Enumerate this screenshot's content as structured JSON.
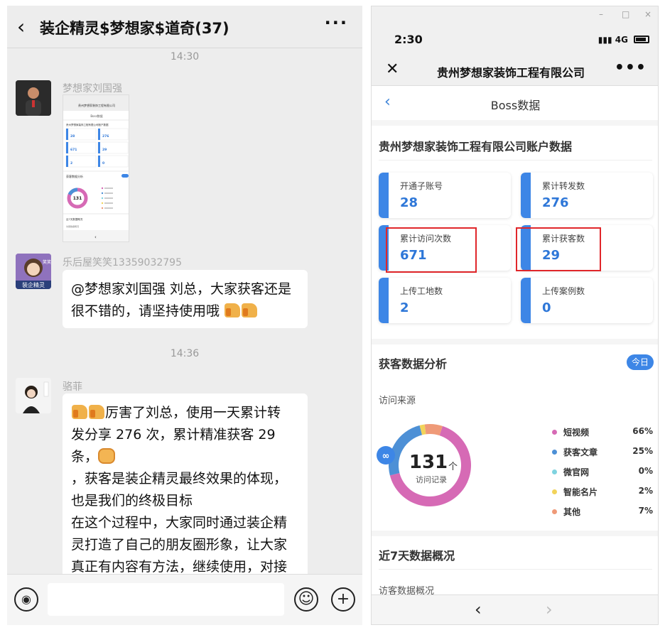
{
  "chat": {
    "title": "装企精灵$梦想家$道奇(37)",
    "back_icon": "chevron-left-icon",
    "more_icon": "more-icon",
    "messages": [
      {
        "time": "14:30",
        "sender": "梦想家刘国强",
        "type": "image"
      },
      {
        "sender": "乐后屋笑笑13359032795",
        "avatar_text": "装企精灵",
        "avatar_top": "笑笑",
        "text_lines": [
          "@梦想家刘国强 刘总，大家获客还是",
          "很不错的，请坚持使用哦 "
        ]
      },
      {
        "time": "14:36",
        "sender": "骆菲",
        "text_lines": [
          "厉害了刘总，使用一天累计转",
          "发分享 276 次，累计精准获客 29",
          "条，",
          "，获客是装企精灵最终效果的体现，",
          "也是我们的终极目标",
          "在这个过程中，大家同时通过装企精",
          "灵打造了自己的朋友圈形象，让大家",
          "真正有内容有方法，继续使用，对接"
        ]
      }
    ],
    "bottom": {
      "voice_icon": "voice-icon",
      "emoji_icon": "emoji-icon",
      "add_icon": "add-icon"
    }
  },
  "thumbnail": {
    "company": "贵州梦想家装饰工程有限公司",
    "page": "Boss数据",
    "account_title": "贵州梦想家装饰工程有限公司账户数据",
    "values": [
      "28",
      "276",
      "671",
      "29",
      "2",
      "0"
    ],
    "center": "131",
    "analysis": "获客数据分析",
    "week": "近7天数据概况",
    "visitors": "访客数据概况"
  },
  "app": {
    "window": {
      "minimize": "–",
      "maximize": "□",
      "close": "×"
    },
    "status": {
      "time": "2:30",
      "network": "4G",
      "battery_icon": "battery-icon",
      "signal_icon": "signal-icon"
    },
    "nav": {
      "close_icon": "close-icon",
      "title": "贵州梦想家装饰工程有限公司",
      "more": "•••"
    },
    "page": {
      "back": "‹",
      "title": "Boss数据"
    },
    "account": {
      "title": "贵州梦想家装饰工程有限公司账户数据",
      "stats": [
        {
          "label": "开通子账号",
          "value": "28"
        },
        {
          "label": "累计转发数",
          "value": "276"
        },
        {
          "label": "累计访问次数",
          "value": "671"
        },
        {
          "label": "累计获客数",
          "value": "29"
        },
        {
          "label": "上传工地数",
          "value": "2"
        },
        {
          "label": "上传案例数",
          "value": "0"
        }
      ]
    },
    "analysis": {
      "title": "获客数据分析",
      "today": "今日",
      "source_label": "访问来源",
      "center_value": "131",
      "center_unit": "个",
      "center_label": "访问记录",
      "link_icon": "link-icon",
      "legend": [
        {
          "name": "短视频",
          "pct": "66%",
          "value": 66,
          "color": "#d66ab5"
        },
        {
          "name": "获客文章",
          "pct": "25%",
          "value": 25,
          "color": "#4d90d6"
        },
        {
          "name": "微官网",
          "pct": "0%",
          "value": 0,
          "color": "#7fd3e0"
        },
        {
          "name": "智能名片",
          "pct": "2%",
          "value": 2,
          "color": "#f2d35a"
        },
        {
          "name": "其他",
          "pct": "7%",
          "value": 7,
          "color": "#ef9a78"
        }
      ]
    },
    "week": {
      "title": "近7天数据概况",
      "visitors": "访客数据概况"
    },
    "bottom": {
      "back": "‹",
      "forward": "›"
    }
  }
}
